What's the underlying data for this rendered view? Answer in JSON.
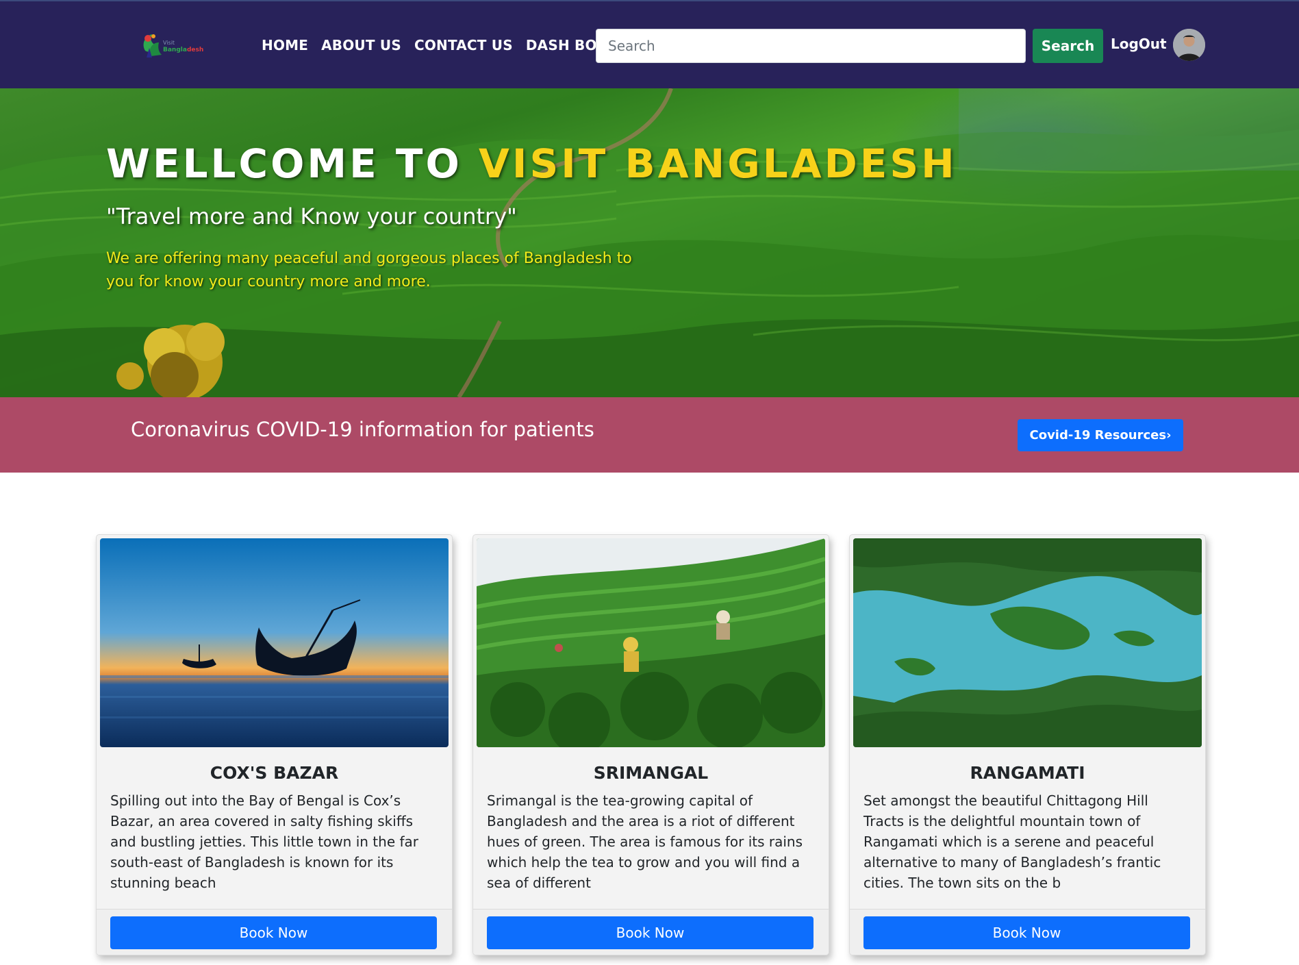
{
  "navbar": {
    "logo_text": "Visit Bangladesh",
    "links": [
      "HOME",
      "ABOUT US",
      "CONTACT US",
      "DASH BOARD"
    ],
    "search_placeholder": "Search",
    "search_button": "Search",
    "logout": "LogOut"
  },
  "hero": {
    "title_white": "WELLCOME TO ",
    "title_yellow": "VISIT BANGLADESH",
    "subtitle": "\"Travel more and Know your country\"",
    "description": "We are offering many peaceful and gorgeous places of Bangladesh to you for know your country more and more."
  },
  "covid": {
    "text": "Coronavirus COVID-19 information for patients",
    "button": "Covid-19 Resources›"
  },
  "cards": [
    {
      "title": "COX'S BAZAR",
      "text": "Spilling out into the Bay of Bengal is Cox’s Bazar, an area covered in salty fishing skiffs and bustling jetties. This little town in the far south-east of Bangladesh is known for its stunning beach",
      "button": "Book Now"
    },
    {
      "title": "SRIMANGAL",
      "text": "Srimangal is the tea-growing capital of Bangladesh and the area is a riot of different hues of green. The area is famous for its rains which help the tea to grow and you will find a sea of different",
      "button": "Book Now"
    },
    {
      "title": "RANGAMATI",
      "text": "Set amongst the beautiful Chittagong Hill Tracts is the delightful mountain town of Rangamati which is a serene and peaceful alternative to many of Bangladesh’s frantic cities. The town sits on the b",
      "button": "Book Now"
    }
  ],
  "colors": {
    "navbar_bg": "#28225a",
    "search_button_bg": "#198754",
    "covid_bg": "#ad4a66",
    "primary_button": "#0d6efd",
    "title_yellow": "#f7d21a",
    "desc_yellow": "#f3ec1a"
  }
}
